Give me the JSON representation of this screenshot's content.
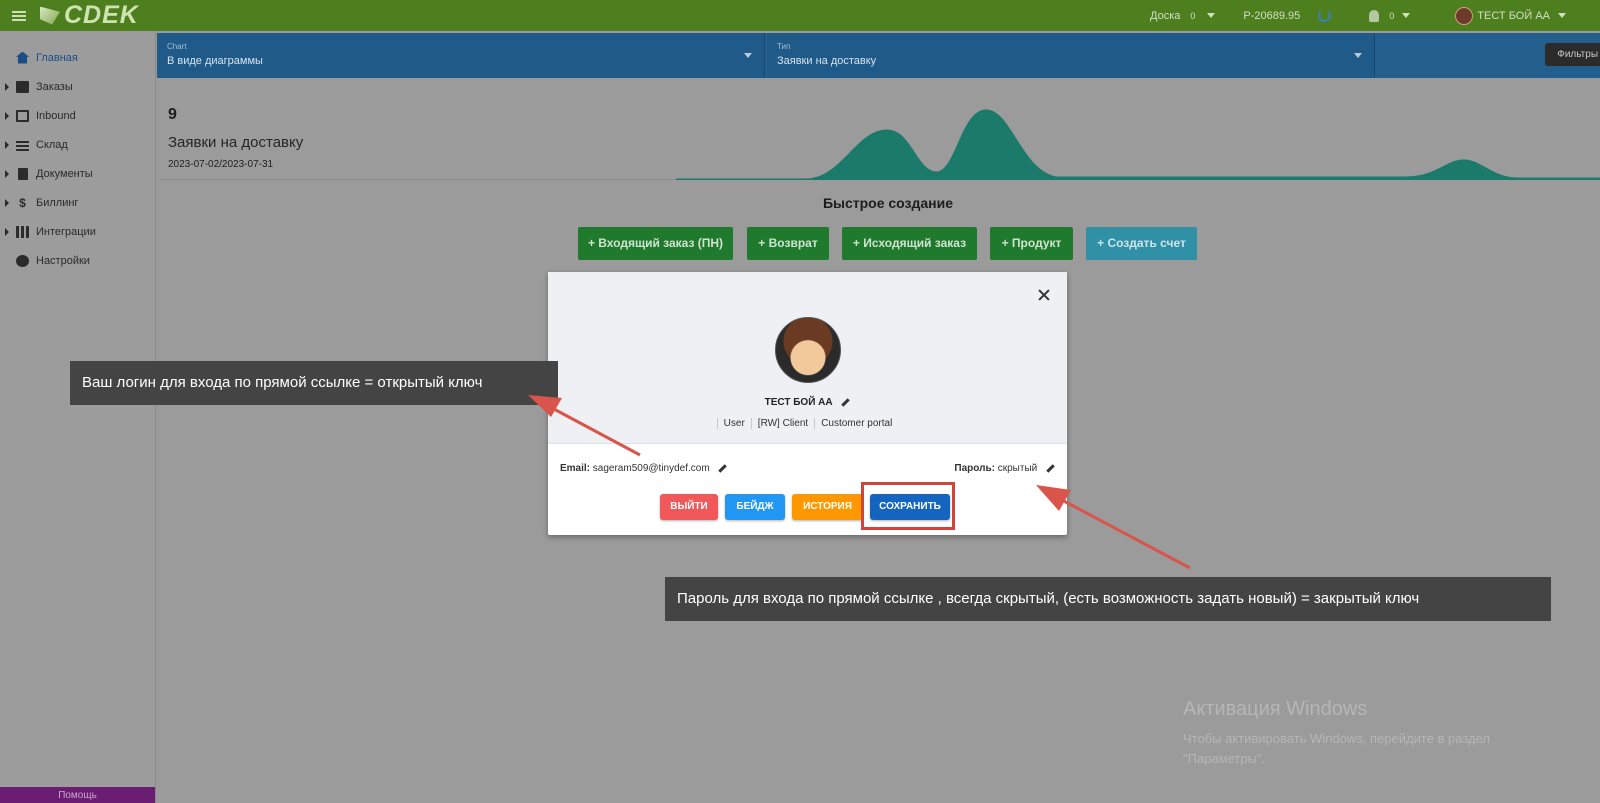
{
  "topbar": {
    "brand": "CDEK",
    "board_label": "Доска",
    "board_count": "0",
    "balance": "P-20689.95",
    "notifications_count": "0",
    "user_name": "ТЕСТ БОЙ АА"
  },
  "sidebar": {
    "items": [
      {
        "label": "Главная",
        "icon": "home-icon"
      },
      {
        "label": "Заказы",
        "icon": "orders-icon"
      },
      {
        "label": "Inbound",
        "icon": "inbound-icon"
      },
      {
        "label": "Склад",
        "icon": "warehouse-icon"
      },
      {
        "label": "Документы",
        "icon": "document-icon"
      },
      {
        "label": "Биллинг",
        "icon": "dollar-icon"
      },
      {
        "label": "Интеграции",
        "icon": "grid-icon"
      },
      {
        "label": "Настройки",
        "icon": "gear-icon"
      }
    ],
    "help_label": "Помощь"
  },
  "filters": {
    "chart_label": "Chart",
    "chart_value": "В виде диаграммы",
    "type_label": "Тип",
    "type_value": "Заявки на доставку",
    "filters_button": "Фильтры"
  },
  "summary": {
    "count": "9",
    "title": "Заявки на доставку",
    "range": "2023-07-02/2023-07-31"
  },
  "quick_create": {
    "title": "Быстрое создание",
    "buttons": [
      "+ Входящий заказ (ПН)",
      "+ Возврат",
      "+ Исходящий заказ",
      "+ Продукт",
      "+ Создать счет"
    ]
  },
  "profile_modal": {
    "name": "ТЕСТ БОЙ АА",
    "roles": [
      "User",
      "[RW] Client",
      "Customer portal"
    ],
    "email_label": "Email:",
    "email_value": "sageram509@tinydef.com",
    "password_label": "Пароль:",
    "password_value": "скрытый",
    "buttons": {
      "logout": "ВЫЙТИ",
      "badge": "БЕЙДЖ",
      "history": "ИСТОРИЯ",
      "save": "СОХРАНИТЬ"
    }
  },
  "annotations": {
    "login": "Ваш логин для входа по прямой ссылке =  открытый ключ",
    "password": "Пароль для входа по прямой ссылке , всегда скрытый,  (есть возможность задать новый) = закрытый ключ",
    "arrow_color": "#d9544b"
  },
  "watermark": {
    "title": "Активация Windows",
    "line1": "Чтобы активировать Windows, перейдите в раздел",
    "line2": "\"Параметры\"."
  },
  "colors": {
    "topbar": "#4e7f1f",
    "filter_bar": "#245e8c",
    "quick_green": "#1f7a2e",
    "quick_teal": "#2f90a6",
    "logout": "#f0585a",
    "badge": "#2196f3",
    "history": "#ff9800",
    "save": "#1565c0",
    "spark": "#1b7a6a"
  }
}
